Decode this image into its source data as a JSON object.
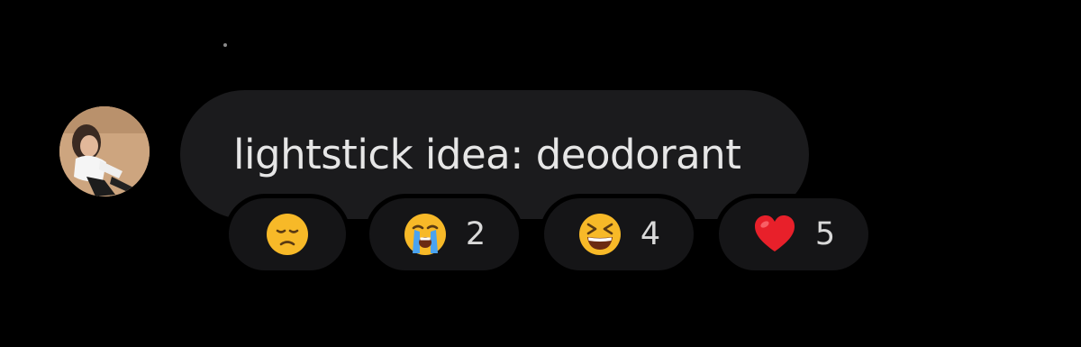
{
  "comment": {
    "text": "lightstick idea: deodorant"
  },
  "reactions": [
    {
      "emoji_name": "disappointed-face-icon",
      "count": ""
    },
    {
      "emoji_name": "loudly-crying-face-icon",
      "count": "2"
    },
    {
      "emoji_name": "grinning-squinting-face-icon",
      "count": "4"
    },
    {
      "emoji_name": "red-heart-icon",
      "count": "5"
    }
  ],
  "colors": {
    "background": "#000000",
    "bubble": "#1b1b1d",
    "pill": "#151517",
    "text": "#e6e6e6"
  }
}
